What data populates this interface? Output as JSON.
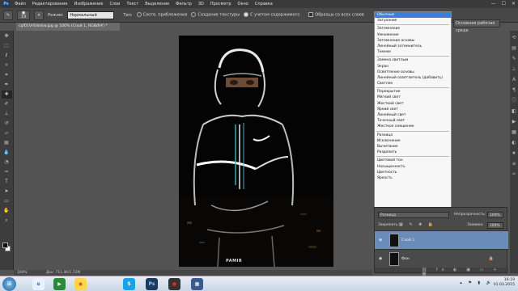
{
  "app": {
    "logo": "Ps"
  },
  "menu": [
    "Файл",
    "Редактирование",
    "Изображение",
    "Слои",
    "Текст",
    "Выделение",
    "Фильтр",
    "3D",
    "Просмотр",
    "Окно",
    "Справка"
  ],
  "window_controls": [
    "—",
    "☐",
    "✕"
  ],
  "options": {
    "brush_size": "19",
    "mode_label": "Режим:",
    "mode_value": "Нормальный",
    "type_label": "Тип:",
    "radio_proximity": "Соотв. приблежения",
    "radio_texture": "Создание текстуры",
    "radio_content_aware": "С учетом содержимого",
    "sample_all": "Образцы со всех слоев",
    "workspace": "Основная рабочая среда"
  },
  "document_tab": "cqf01Vr6dmkw.jpg @ 100% (Слой 1, RGB/8#) *",
  "blend_modes": [
    [
      "Обычные",
      "Затухание"
    ],
    [
      "Затемнение",
      "Умножение",
      "Затемнение основы",
      "Линейный затемнитель",
      "Темнее"
    ],
    [
      "Замена светлым",
      "Экран",
      "Осветление основы",
      "Линейный осветлитель (добавить)",
      "Светлее"
    ],
    [
      "Перекрытие",
      "Мягкий свет",
      "Жесткий свет",
      "Яркий свет",
      "Линейный свет",
      "Точечный свет",
      "Жесткое смешение"
    ],
    [
      "Разница",
      "Исключение",
      "Вычитание",
      "Разделить"
    ],
    [
      "Цветовой тон",
      "Насыщенность",
      "Цветность",
      "Яркость"
    ]
  ],
  "blend_selected": "Обычные",
  "layers_panel": {
    "blend_value": "Разница",
    "opacity_label": "Непрозрачность:",
    "opacity_value": "100%",
    "lock_label": "Закрепить:",
    "fill_label": "Заливка:",
    "fill_value": "100%",
    "layers": [
      {
        "name": "Слой 1",
        "active": true
      },
      {
        "name": "Фон",
        "active": false
      }
    ],
    "footer_icons": "⛓ fx ◐ ▣ ▭ ＋ 🗑"
  },
  "status": {
    "zoom": "100%",
    "doc": "Док: 711,4K/1,72M"
  },
  "taskbar": {
    "apps": [
      {
        "label": "e",
        "color": "#2a6fd6",
        "bg": "#e9f1ff"
      },
      {
        "label": "▶",
        "color": "#fff",
        "bg": "#2a8a3a"
      },
      {
        "label": "◉",
        "color": "#d33",
        "bg": "#ffd64a"
      },
      {
        "label": "S",
        "color": "#fff",
        "bg": "#17a3e6"
      },
      {
        "label": "Ps",
        "color": "#8ec5ff",
        "bg": "#1d3b5e"
      },
      {
        "label": "●",
        "color": "#e22",
        "bg": "#333"
      },
      {
        "label": "▦",
        "color": "#fff",
        "bg": "#3b5b8f"
      }
    ],
    "time": "16:19",
    "date": "01.03.2015"
  },
  "canvas_watermark": "PAMIR"
}
